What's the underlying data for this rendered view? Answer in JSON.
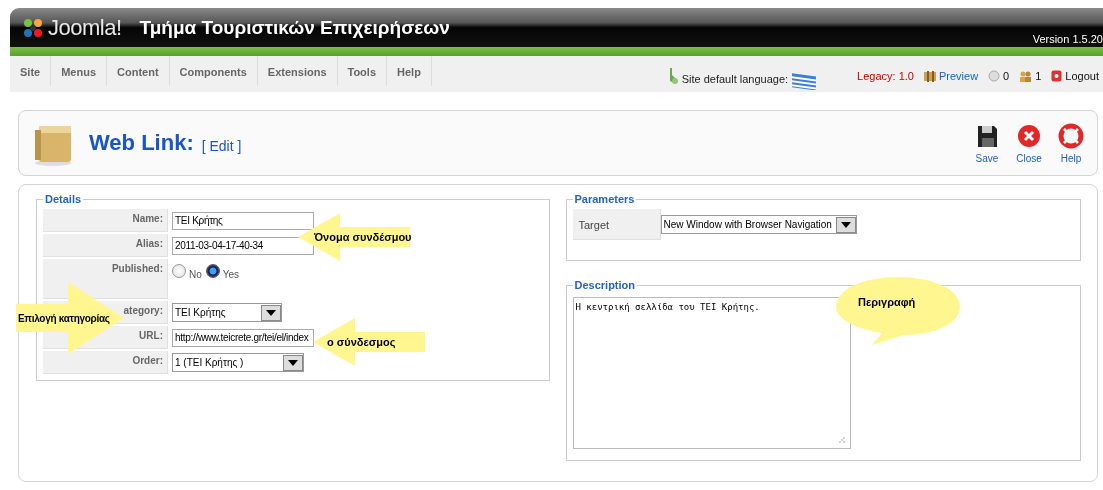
{
  "header": {
    "logo_text": "Joomla!",
    "site_title": "Τμήμα Τουριστικών Επιχειρήσεων",
    "version": "Version 1.5.20"
  },
  "menu": {
    "items": [
      {
        "label": "Site"
      },
      {
        "label": "Menus"
      },
      {
        "label": "Content"
      },
      {
        "label": "Components"
      },
      {
        "label": "Extensions"
      },
      {
        "label": "Tools"
      },
      {
        "label": "Help"
      }
    ]
  },
  "status": {
    "language_label": "Site default language:",
    "legacy": "Legacy: 1.0",
    "preview": "Preview",
    "messages": "0",
    "users": "1",
    "logout": "Logout"
  },
  "toolbar": {
    "title": "Web Link:",
    "subtitle": "[ Edit ]",
    "buttons": [
      {
        "label": "Save",
        "kind": "save"
      },
      {
        "label": "Close",
        "kind": "close"
      },
      {
        "label": "Help",
        "kind": "help"
      }
    ]
  },
  "details": {
    "legend": "Details",
    "rows": [
      {
        "label": "Name:",
        "kind": "text",
        "value": "TEI Κρήτης"
      },
      {
        "label": "Alias:",
        "kind": "text",
        "value": "2011-03-04-17-40-34"
      },
      {
        "label": "Published:",
        "kind": "radio",
        "options": [
          {
            "label": "No",
            "selected": false
          },
          {
            "label": "Yes",
            "selected": true
          }
        ]
      },
      {
        "label": "ategory:",
        "kind": "select",
        "value": "TEI Κρήτης"
      },
      {
        "label": "URL:",
        "kind": "text",
        "value": "http://www.teicrete.gr/tei/el/index"
      },
      {
        "label": "Order:",
        "kind": "select",
        "value": "1 (TEI Κρήτης )"
      }
    ]
  },
  "parameters": {
    "legend": "Parameters",
    "rows": [
      {
        "label": "Target",
        "kind": "select",
        "value": "New Window with Browser Navigation"
      }
    ]
  },
  "description": {
    "legend": "Description",
    "text": "Η κεντρική σελλίδα του TEI Κρήτης."
  },
  "annotations": [
    {
      "text": "Όνομα συνδέσμου",
      "kind": "arrow-left"
    },
    {
      "text": "Επιλογή κατηγορίας",
      "kind": "arrow-right"
    },
    {
      "text": "ο σύνδεσμος",
      "kind": "arrow-left"
    },
    {
      "text": "Περιγραφή",
      "kind": "bubble"
    }
  ]
}
